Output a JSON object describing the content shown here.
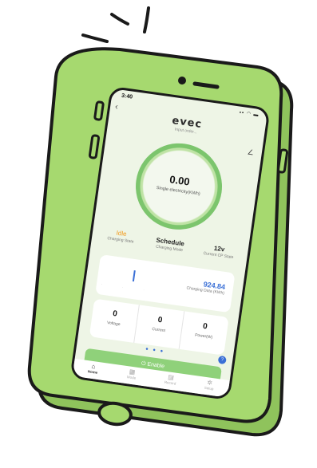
{
  "status_bar": {
    "time": "3:40",
    "icons": "▪▪ ◠ ▬"
  },
  "header": {
    "back_icon": "chevron-left-icon",
    "logo": "evec",
    "subtitle": "Input order...",
    "edit_icon": "edit-icon"
  },
  "gauge": {
    "value": "0.00",
    "label": "Single electricity(KWh)",
    "color": "#7cc56d"
  },
  "stats": [
    {
      "value": "Idle",
      "label": "Charging State"
    },
    {
      "value": "Schedule",
      "label": "Charging Mode"
    },
    {
      "value": "12v",
      "label": "Current CP State"
    }
  ],
  "charge_card": {
    "value": "924.84",
    "label": "Charging Data (KWh)"
  },
  "metrics": [
    {
      "value": "0",
      "label": "Voltage"
    },
    {
      "value": "0",
      "label": "Current"
    },
    {
      "value": "0",
      "label": "Power(W)"
    }
  ],
  "help_badge": "?",
  "enable_button": {
    "label": "Enable",
    "icon": "power-icon"
  },
  "tabs": [
    {
      "label": "Home",
      "icon": "home-icon",
      "active": true
    },
    {
      "label": "Mode",
      "icon": "grid-icon",
      "active": false
    },
    {
      "label": "Record",
      "icon": "record-icon",
      "active": false
    },
    {
      "label": "Setup",
      "icon": "gear-icon",
      "active": false
    }
  ],
  "colors": {
    "phone_body": "#a6d96f",
    "accent_green": "#8fd17a",
    "accent_blue": "#3a6fd6",
    "idle_orange": "#f29a1c"
  }
}
